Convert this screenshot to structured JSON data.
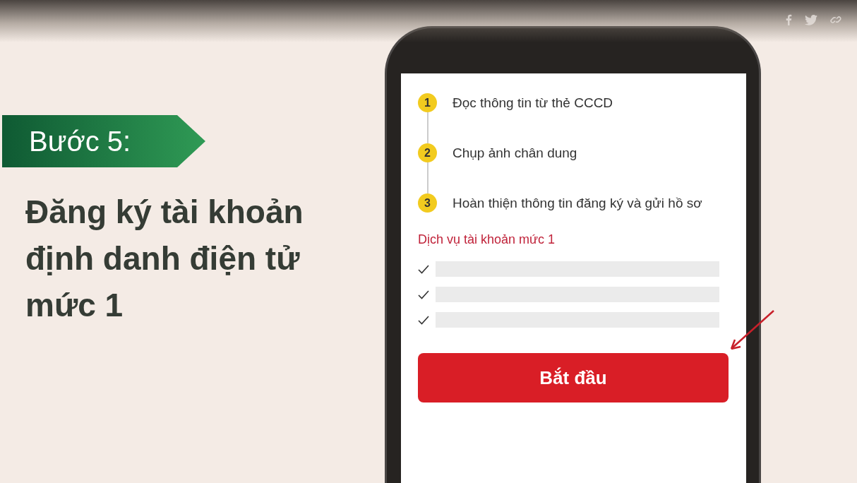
{
  "step_banner": {
    "label": "Bước 5:"
  },
  "heading": "Đăng ký tài khoản định danh điện tử mức 1",
  "phone": {
    "steps": [
      {
        "number": "1",
        "label": "Đọc thông tin từ thẻ CCCD"
      },
      {
        "number": "2",
        "label": "Chụp ảnh chân dung"
      },
      {
        "number": "3",
        "label": "Hoàn thiện thông tin đăng ký và gửi hồ sơ"
      }
    ],
    "service_title": "Dịch vụ tài khoản mức 1",
    "service_items": [
      {
        "checked": true
      },
      {
        "checked": true
      },
      {
        "checked": true
      }
    ],
    "start_button": "Bắt đầu"
  }
}
